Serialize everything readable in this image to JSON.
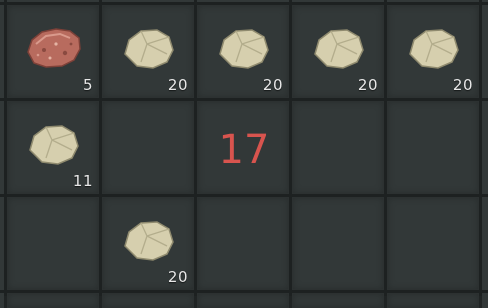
{
  "inventory": {
    "slots": [
      {
        "icon": "copper-ore-icon",
        "count": "5"
      },
      {
        "icon": "stone-icon",
        "count": "20"
      },
      {
        "icon": "stone-icon",
        "count": "20"
      },
      {
        "icon": "stone-icon",
        "count": "20"
      },
      {
        "icon": "stone-icon",
        "count": "20"
      },
      {
        "icon": "stone-icon",
        "count": "11"
      },
      {
        "icon": "stone-icon",
        "count": "20"
      }
    ],
    "overlay_number": "17"
  },
  "colors": {
    "slot_bg": "#323838",
    "grid_bg": "#1d2121",
    "count_text": "#e8e8e8",
    "overlay_text": "#d8544e",
    "stone": "#d6cfae",
    "copper_ore": "#b86b5e"
  }
}
